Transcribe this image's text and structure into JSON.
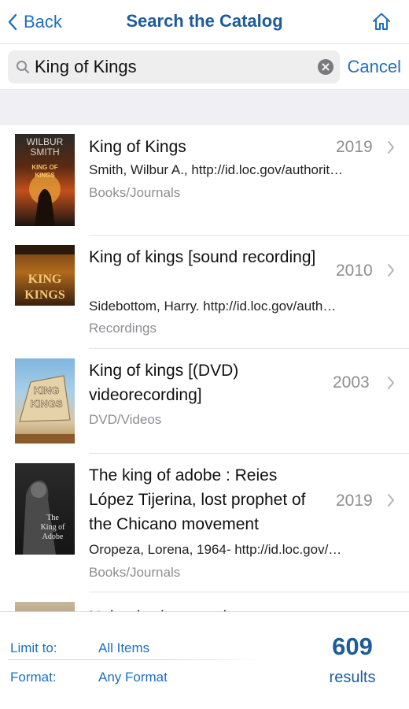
{
  "nav": {
    "back_label": "Back",
    "title": "Search the Catalog"
  },
  "search": {
    "query": "King of Kings",
    "cancel_label": "Cancel"
  },
  "results": [
    {
      "title": "King of Kings",
      "year": "2019",
      "author": "Smith, Wilbur A., http://id.loc.gov/authorit…",
      "type": "Books/Journals",
      "cover_text": [
        "WILBUR",
        "SMITH",
        "KING OF",
        "KINGS"
      ]
    },
    {
      "title": "King of kings [sound recording]",
      "year": "2010",
      "author": "Sidebottom, Harry. http://id.loc.gov/auth…",
      "type": "Recordings",
      "cover_text": [
        "KING",
        "KINGS"
      ]
    },
    {
      "title": "King of kings [(DVD) videorecording]",
      "year": "2003",
      "author": "",
      "type": "DVD/Videos",
      "cover_text": [
        "KING",
        "KINGS"
      ]
    },
    {
      "title": "The king of adobe : Reies López Tijerina, lost prophet of the Chicano movement",
      "year": "2019",
      "author": "Oropeza, Lorena, 1964- http://id.loc.gov/…",
      "type": "Books/Journals",
      "cover_text": [
        "The",
        "King of",
        "Adobe"
      ]
    },
    {
      "title": "Nebuchadnezzar the",
      "year": "",
      "author": "",
      "type": ""
    }
  ],
  "filters": {
    "limit_label": "Limit to:",
    "limit_value": "All Items",
    "format_label": "Format:",
    "format_value": "Any Format"
  },
  "summary": {
    "count": "609",
    "count_label": "results"
  },
  "colors": {
    "accent": "#1f6fc0",
    "title_blue": "#1d5c9b",
    "secondary_text": "#8e8e93"
  }
}
